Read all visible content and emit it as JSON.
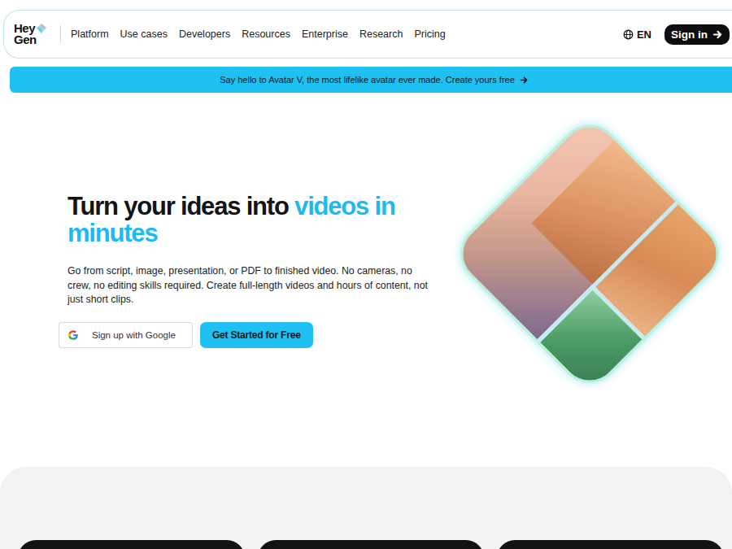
{
  "nav": {
    "logo": {
      "line1": "Hey",
      "line2": "Gen"
    },
    "items": [
      "Platform",
      "Use cases",
      "Developers",
      "Resources",
      "Enterprise",
      "Research",
      "Pricing"
    ],
    "language": "EN",
    "sign_in": "Sign in"
  },
  "banner": {
    "text": "Say hello to Avatar V, the most lifelike avatar ever made. Create yours free"
  },
  "hero": {
    "title": "Turn your ideas into ",
    "title_accent": "videos in minutes",
    "body": "Go from script, image, presentation, or PDF to finished video. No cameras, no crew, no editing skills required. Create full-length videos and hours of content, not just short clips.",
    "google_button": "Sign up with Google",
    "cta": "Get Started for Free"
  }
}
